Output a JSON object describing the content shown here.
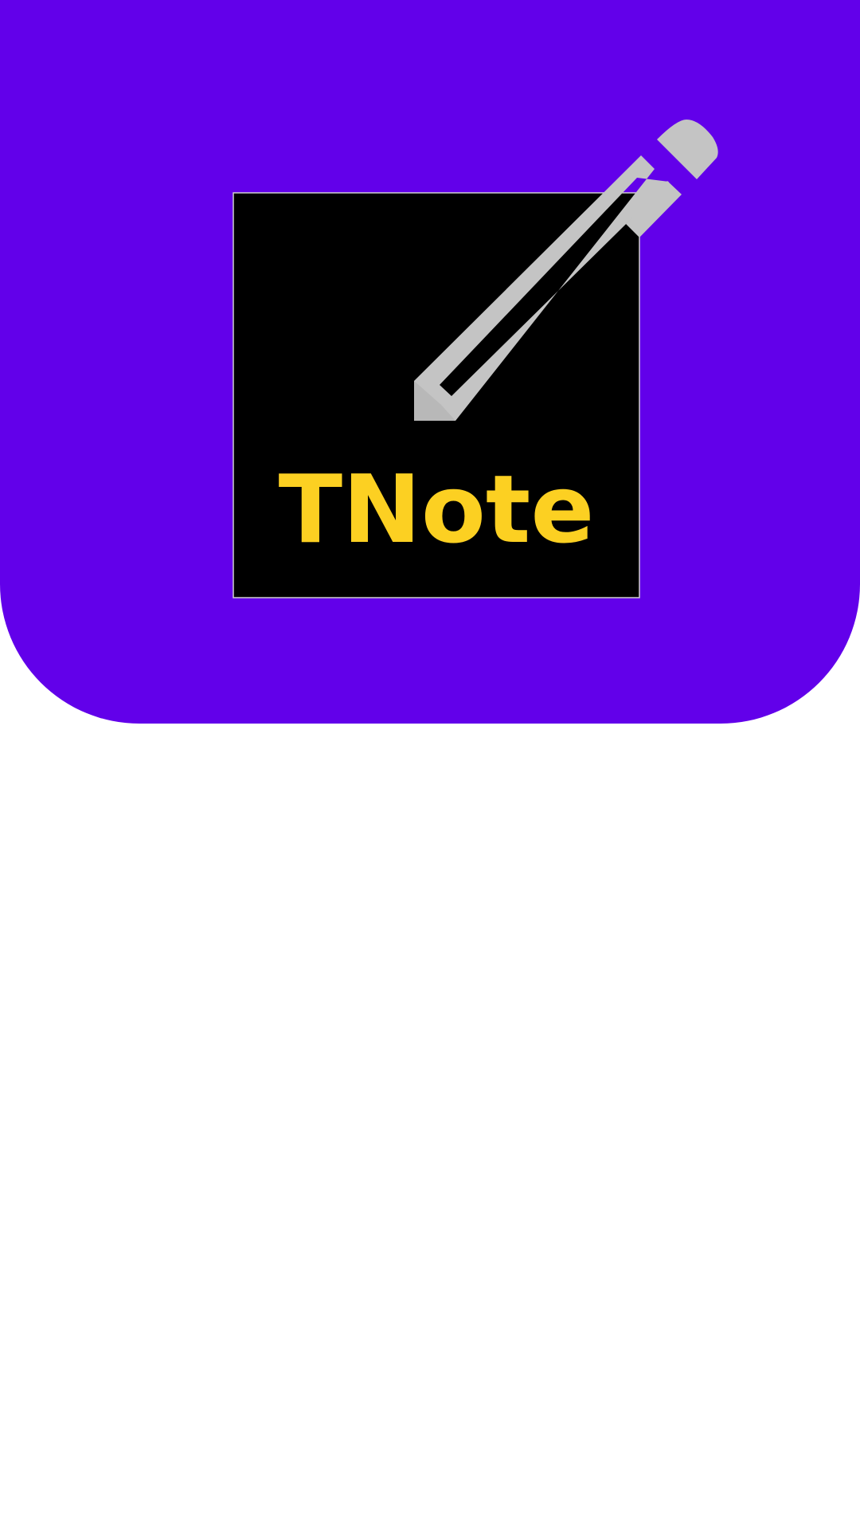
{
  "app": {
    "name": "TNote"
  },
  "splash": {
    "logo_icon": "pencil-icon",
    "colors": {
      "background": "#6200ea",
      "logo_square": "#000000",
      "wordmark": "#fcd022",
      "pencil": "#c4c4c4",
      "page": "#ffffff"
    }
  }
}
